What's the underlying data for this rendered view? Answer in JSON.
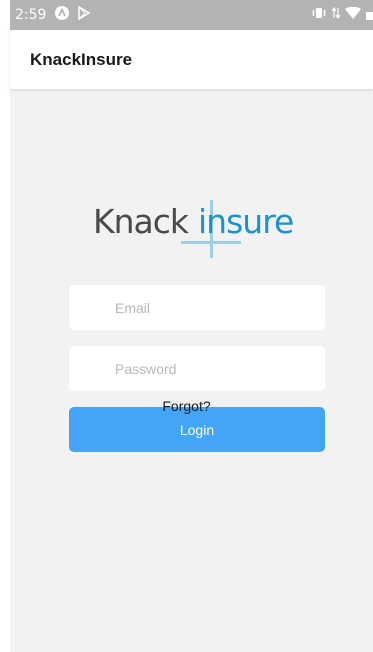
{
  "status_bar": {
    "time": "2:59",
    "left_icons": [
      "a-logo-icon",
      "play-store-icon"
    ],
    "right_icons": [
      "vibrate-icon",
      "data-arrows-icon",
      "wifi-icon",
      "battery-icon"
    ]
  },
  "header": {
    "title": "KnackInsure"
  },
  "logo": {
    "part1": "Knack",
    "part2": "insure",
    "part1_color": "#4a4a4a",
    "part2_color": "#1793d0"
  },
  "form": {
    "email_placeholder": "Email",
    "email_value": "",
    "password_placeholder": "Password",
    "password_value": "",
    "login_label": "Login",
    "forgot_label": "Forgot?"
  },
  "colors": {
    "accent": "#42a5f5",
    "background": "#f2f2f2",
    "status_bar": "#b3b3b3"
  }
}
